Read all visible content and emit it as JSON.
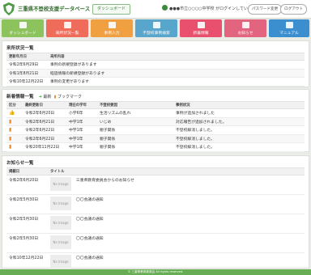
{
  "header": {
    "title": "三重県不登校支援データベース",
    "dashboard_label": "ダッシュボード",
    "school_text": "●●●市立○○○○中学校 がログインしています",
    "password_label": "パスワード変更",
    "logout_label": "ログアウト"
  },
  "nav": {
    "tiles": [
      {
        "label": "ダッシュボード",
        "color": "#8cc35c"
      },
      {
        "label": "来所状況一覧",
        "color": "#ef6c5a"
      },
      {
        "label": "事例入力",
        "color": "#f0a040"
      },
      {
        "label": "不登校事例検索",
        "color": "#58a6cc"
      },
      {
        "label": "新着情報",
        "color": "#e9506e"
      },
      {
        "label": "お知らせ",
        "color": "#e3647e"
      },
      {
        "label": "マニュアル",
        "color": "#3b8fcf"
      }
    ]
  },
  "recent_cases": {
    "title": "来所状況一覧",
    "columns": [
      "更新年月日",
      "来所内容"
    ],
    "rows": [
      {
        "date": "令和2年6月29日",
        "content": "事例の新規登録があります"
      },
      {
        "date": "令和1年8月21日",
        "content": "経過情報の新規登録があります"
      },
      {
        "date": "令和10年12月22日",
        "content": "事例の変更があります"
      }
    ]
  },
  "news": {
    "title": "新着情報一覧",
    "legend_new": "最新",
    "legend_bookmark": "ブックマーク",
    "columns": [
      "区分",
      "最終更新日",
      "現在の学年",
      "不登校要因",
      "事例状況"
    ],
    "rows": [
      {
        "type": "thumb",
        "date": "令和2年6月20日",
        "grade": "小学6年",
        "cause": "生活リズムの乱れ",
        "status": "事例が追加されました"
      },
      {
        "type": "bookmark",
        "date": "令和2年6月21日",
        "grade": "中学1年",
        "cause": "いじめ",
        "status": "対応報告が追加されました。"
      },
      {
        "type": "bookmark",
        "date": "令和2年6月22日",
        "grade": "中学1年",
        "cause": "親子関係",
        "status": "不登校解消しました。"
      },
      {
        "type": "bookmark",
        "date": "令和2年6月22日",
        "grade": "中学1年",
        "cause": "親子関係",
        "status": "不登校解消しました。"
      },
      {
        "type": "bookmark",
        "date": "令和20年11月22日",
        "grade": "中学1年",
        "cause": "親子関係",
        "status": "不登校解消しました。"
      }
    ]
  },
  "notices": {
    "title": "お知らせ一覧",
    "columns": [
      "掲載日",
      "タイトル"
    ],
    "no_image_label": "No Image",
    "rows": [
      {
        "date": "令和2年6月20日",
        "title": "三重県教育委員会からのお知らせ"
      },
      {
        "date": "令和2年5月30日",
        "title": "〇〇会議の通知"
      },
      {
        "date": "令和2年5月30日",
        "title": "〇〇会議の通知"
      },
      {
        "date": "令和2年5月30日",
        "title": "〇〇会議の通知"
      },
      {
        "date": "令和10年12月22日",
        "title": "〇〇会議の通知"
      }
    ]
  },
  "footer": {
    "text": "© 三重県教育委員会 All rights reserved."
  }
}
